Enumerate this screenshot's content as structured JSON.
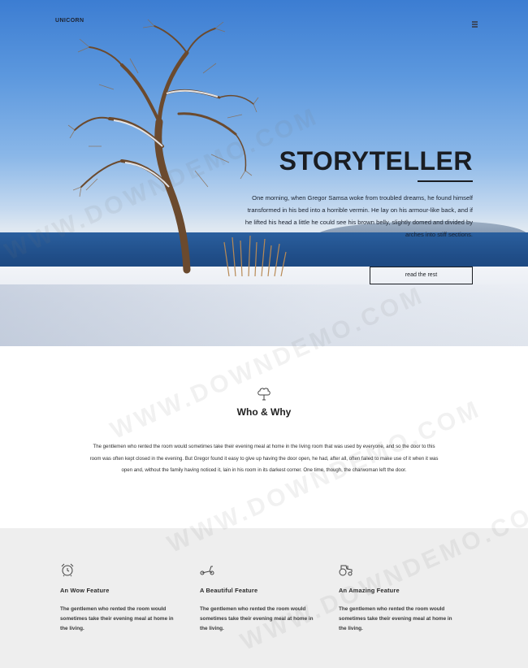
{
  "header": {
    "brand": "UNICORN",
    "menu_icon": "hamburger-menu-icon"
  },
  "hero": {
    "title": "STORYTELLER",
    "text": "One morning, when Gregor Samsa woke from troubled dreams, he found himself transformed in his bed into a horrible vermin. He lay on his armour-like back, and if he lifted his head a little he could see his brown belly, slightly domed and divided by arches into stiff sections.",
    "button_label": "read the rest"
  },
  "who": {
    "icon": "tree-icon",
    "title": "Who & Why",
    "text": "The gentlemen who rented the room would sometimes take their evening meal at home in the living room that was used by everyone, and so the door to this room was often kept closed in the evening. But Gregor found it easy to give up having the door open, he had, after all, often failed to make use of it when it was open and, without the family having noticed it, lain in his room in its darkest corner. One time, though, the charwoman left the door."
  },
  "features": [
    {
      "icon": "alarm-clock-icon",
      "title": "An Wow Feature",
      "text": "The gentlemen who rented the room would sometimes take their evening meal at home in the living."
    },
    {
      "icon": "scooter-icon",
      "title": "A Beautiful Feature",
      "text": "The gentlemen who rented the room would sometimes take their evening meal at home in the living."
    },
    {
      "icon": "tractor-icon",
      "title": "An Amazing Feature",
      "text": "The gentlemen who rented the room would sometimes take their evening meal at home in the living."
    }
  ],
  "watermark": "WWW.DOWNDEMO.COM",
  "colors": {
    "sky": "#5c98de",
    "sea": "#1f4c86",
    "features_bg": "#eeeeee",
    "text_dark": "#1a1d22"
  }
}
